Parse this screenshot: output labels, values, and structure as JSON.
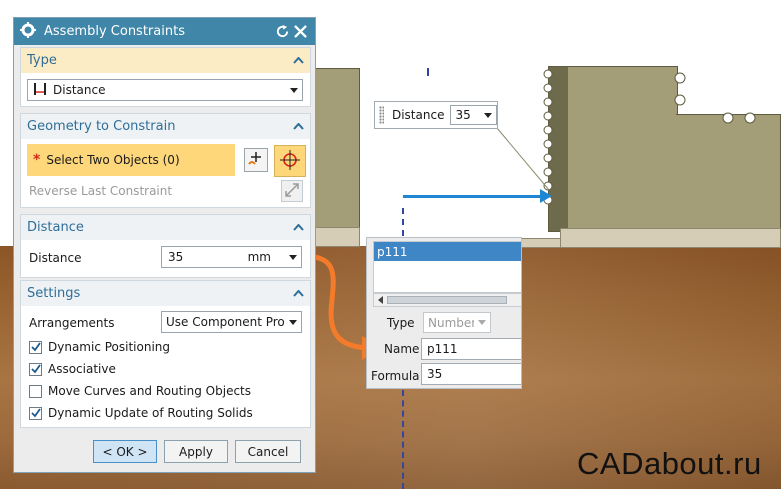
{
  "dialog": {
    "title": "Assembly Constraints",
    "type_section": {
      "heading": "Type",
      "selected": "Distance"
    },
    "geometry_section": {
      "heading": "Geometry to Constrain",
      "select_label": "Select Two Objects (0)",
      "reverse_label": "Reverse Last Constraint"
    },
    "distance_section": {
      "heading": "Distance",
      "label": "Distance",
      "value": "35",
      "unit": "mm"
    },
    "settings_section": {
      "heading": "Settings",
      "arrangements_label": "Arrangements",
      "arrangements_value": "Use Component Properties",
      "checkboxes": [
        {
          "label": "Dynamic Positioning",
          "checked": true
        },
        {
          "label": "Associative",
          "checked": true
        },
        {
          "label": "Move Curves and Routing Objects",
          "checked": false
        },
        {
          "label": "Dynamic Update of Routing Solids",
          "checked": true
        }
      ]
    },
    "buttons": {
      "ok": "< OK >",
      "apply": "Apply",
      "cancel": "Cancel"
    }
  },
  "floating_distance": {
    "label": "Distance",
    "value": "35"
  },
  "expression_panel": {
    "list_item": "p111",
    "type_label": "Type",
    "type_value": "Number",
    "name_label": "Name",
    "name_value": "p111",
    "formula_label": "Formula",
    "formula_value": "35"
  },
  "watermark": "CADabout.ru",
  "colors": {
    "titlebar": "#3f86a8",
    "section_heading": "#2f6e98",
    "active_highlight": "#fdd77a",
    "ok_button": "#cfe4f5",
    "annotation_arrow": "#f47b2a",
    "direction_arrow": "#1f86d3"
  }
}
